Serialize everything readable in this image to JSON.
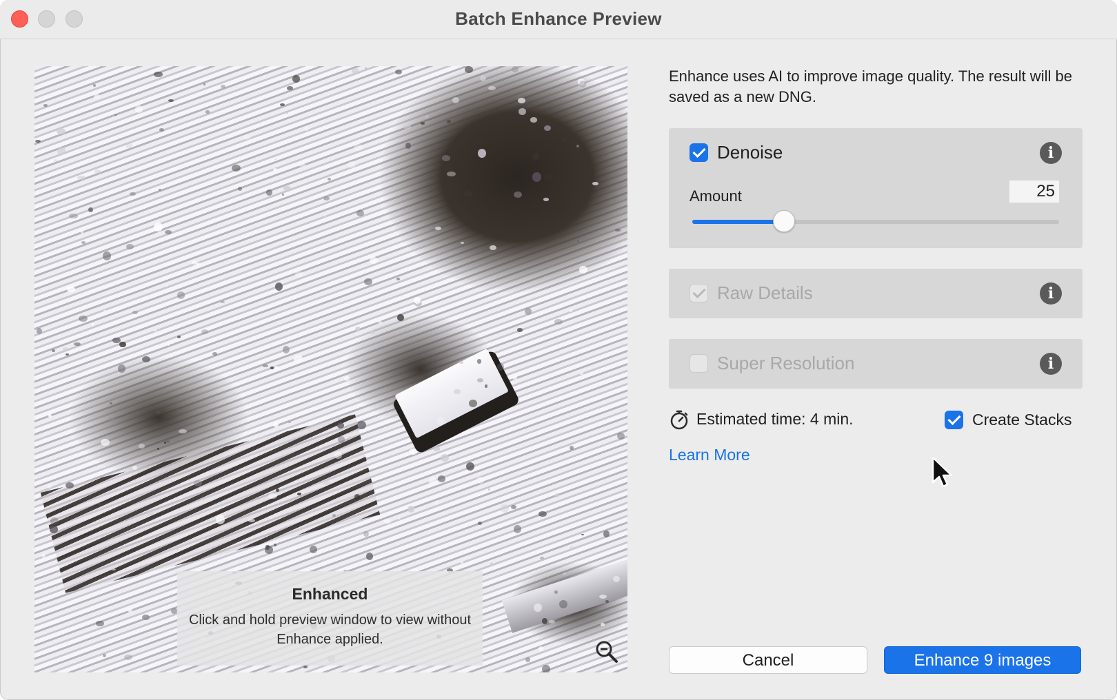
{
  "window": {
    "title": "Batch Enhance Preview"
  },
  "preview": {
    "overlay_title": "Enhanced",
    "overlay_text": "Click and hold preview window to view without Enhance applied.",
    "zoom_icon": "zoom-out-magnifier-icon"
  },
  "panel": {
    "description": "Enhance uses AI to improve image quality. The result will be saved as a new DNG.",
    "denoise": {
      "label": "Denoise",
      "checked": true,
      "amount_label": "Amount",
      "amount_value": "25",
      "slider_fraction": 0.25
    },
    "raw_details": {
      "label": "Raw Details",
      "checked": true,
      "disabled": true
    },
    "super_resolution": {
      "label": "Super Resolution",
      "checked": false,
      "disabled": true
    },
    "estimated_time": "Estimated time: 4 min.",
    "create_stacks": {
      "label": "Create Stacks",
      "checked": true
    },
    "learn_more": "Learn More"
  },
  "buttons": {
    "cancel": "Cancel",
    "enhance": "Enhance 9 images"
  },
  "colors": {
    "accent": "#1a73e8",
    "close": "#ff5f57",
    "panel_bg": "#ececec",
    "section_bg": "#d7d7d7"
  },
  "icons": {
    "info": "info-icon",
    "timer": "stopwatch-icon"
  }
}
